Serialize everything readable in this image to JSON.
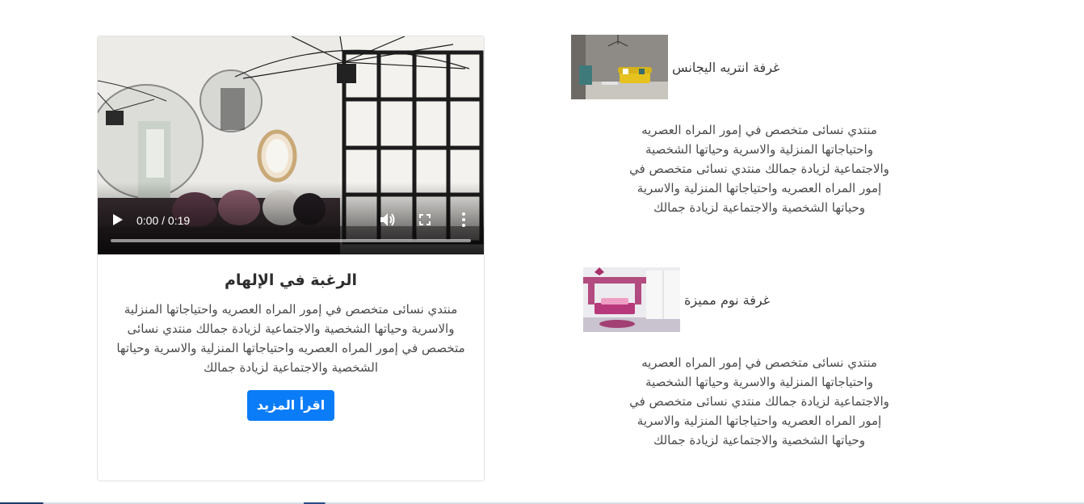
{
  "card": {
    "video": {
      "time_display": "0:00 / 0:19",
      "progress": 0
    },
    "title": "الرغبة في الإلهام",
    "text": "منتدي نسائى متخصص في إمور المراه العصريه واحتياجاتها المنزلية والاسرية وحياتها الشخصية والاجتماعية لزيادة جمالك منتدي نسائى متخصص في إمور المراه العصريه واحتياجاتها المنزلية والاسرية وحياتها الشخصية والاجتماعية لزيادة جمالك",
    "button_label": "اقرأ المزيد"
  },
  "items": [
    {
      "title": "غرفة انتريه اليجانس",
      "description": "منتدي نسائى متخصص في إمور المراه العصريه واحتياجاتها المنزلية والاسرية وحياتها الشخصية والاجتماعية لزيادة جمالك منتدي نسائى متخصص في إمور المراه العصريه واحتياجاتها المنزلية والاسرية وحياتها الشخصية والاجتماعية لزيادة جمالك"
    },
    {
      "title": "غرفة نوم مميزة",
      "description": "منتدي نسائى متخصص في إمور المراه العصريه واحتياجاتها المنزلية والاسرية وحياتها الشخصية والاجتماعية لزيادة جمالك منتدي نسائى متخصص في إمور المراه العصريه واحتياجاتها المنزلية والاسرية وحياتها الشخصية والاجتماعية لزيادة جمالك"
    }
  ],
  "colors": {
    "button": "#0a7cf8",
    "card_border": "#e2e2e2",
    "text": "#4a4a4a"
  },
  "icons": [
    "play-icon",
    "volume-icon",
    "fullscreen-icon",
    "more-options-icon"
  ]
}
